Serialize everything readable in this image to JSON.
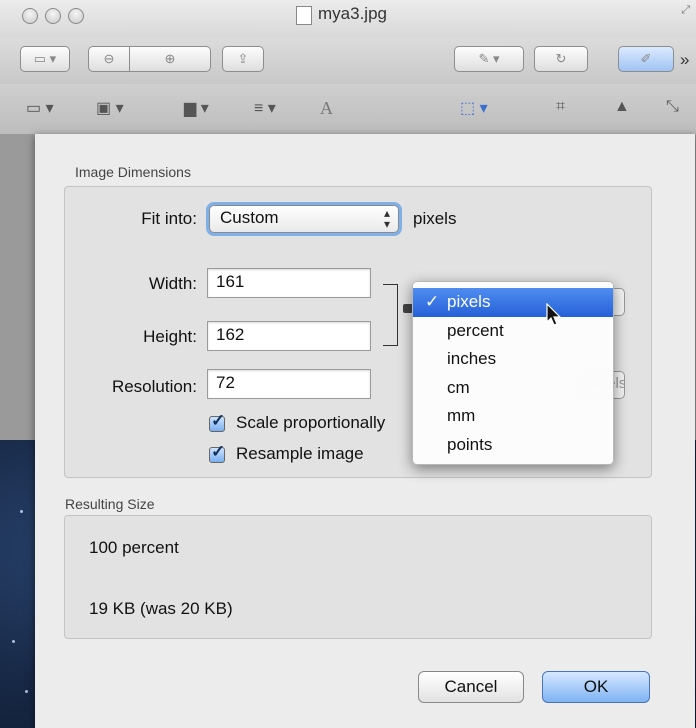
{
  "window": {
    "title": "mya3.jpg"
  },
  "toolbar": {
    "items": [
      {
        "icon": "sidebar-view-icon"
      },
      {
        "icon": "zoom-out-icon"
      },
      {
        "icon": "zoom-in-icon"
      },
      {
        "icon": "share-icon"
      },
      {
        "icon": "annotate-pen-icon"
      },
      {
        "icon": "rotate-icon"
      },
      {
        "icon": "edit-toolbar-icon"
      }
    ],
    "more": "»"
  },
  "edit_toolbar": {
    "text_tool": "A"
  },
  "dialog": {
    "dimensions_heading": "Image Dimensions",
    "fit_into_label": "Fit into:",
    "fit_into_value": "Custom",
    "fit_into_units": "pixels",
    "width_label": "Width:",
    "width_value": "161",
    "height_label": "Height:",
    "height_value": "162",
    "resolution_label": "Resolution:",
    "resolution_value": "72",
    "resolution_units_partial": "pixels/inch",
    "scale_label": "Scale proportionally",
    "scale_checked": true,
    "resample_label": "Resample image",
    "resample_checked": true,
    "result_heading": "Resulting Size",
    "result_percent": "100 percent",
    "result_size": "19 KB (was 20 KB)",
    "cancel_label": "Cancel",
    "ok_label": "OK"
  },
  "units_menu": {
    "check": "✓",
    "items": [
      "pixels",
      "percent",
      "inches",
      "cm",
      "mm",
      "points"
    ],
    "selected": "pixels"
  },
  "colors": {
    "accent": "#2660d8",
    "default_button": "#7fb3f3"
  }
}
